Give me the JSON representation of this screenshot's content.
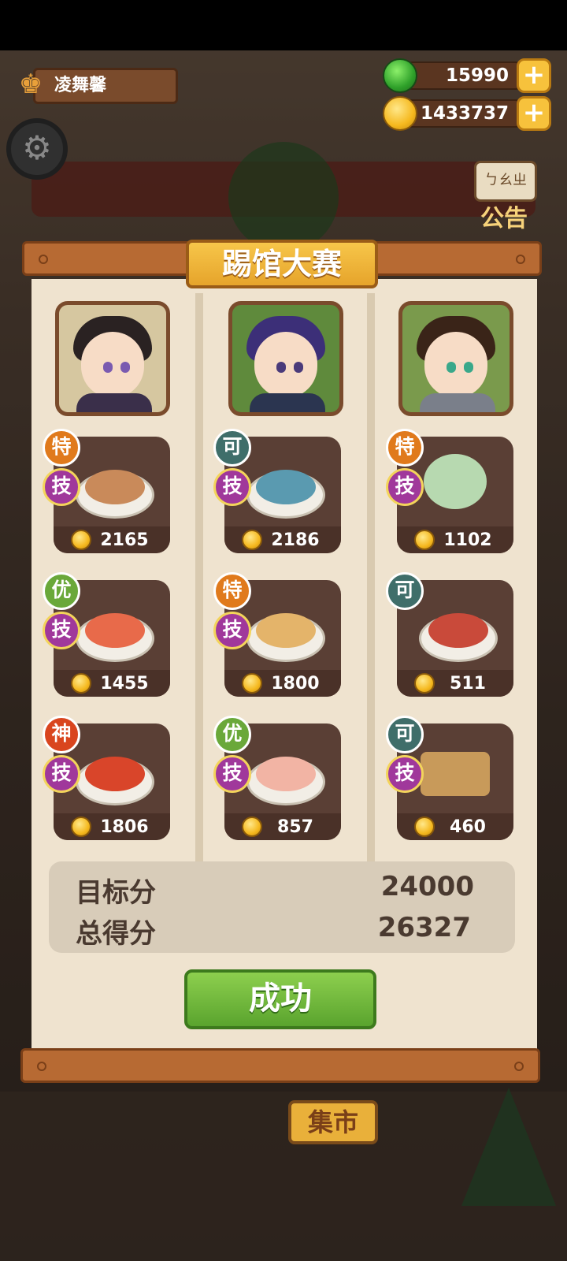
{
  "player": {
    "name": "凌舞馨"
  },
  "currencies": [
    {
      "icon": "green-gem-icon",
      "value": "15990",
      "plus": "+"
    },
    {
      "icon": "gold-coin-icon",
      "value": "1433737",
      "plus": "+"
    }
  ],
  "notice": {
    "sign": "ㄅㄠㄓ",
    "label": "公告"
  },
  "dialog": {
    "title": "踢馆大赛",
    "columns": [
      {
        "character": "long-black-hair-elf",
        "dishes": [
          {
            "grade": "特",
            "skill": "技",
            "score": "2165",
            "food": "dumpling-pot"
          },
          {
            "grade": "优",
            "skill": "技",
            "score": "1455",
            "food": "seafood-salad"
          },
          {
            "grade": "神",
            "skill": "技",
            "score": "1806",
            "food": "crayfish-platter"
          }
        ]
      },
      {
        "character": "purple-hair-elf",
        "dishes": [
          {
            "grade": "可",
            "skill": "技",
            "score": "2186",
            "food": "blue-cake"
          },
          {
            "grade": "特",
            "skill": "技",
            "score": "1800",
            "food": "sponge-cake"
          },
          {
            "grade": "优",
            "skill": "技",
            "score": "857",
            "food": "shrimp-tofu"
          }
        ]
      },
      {
        "character": "curly-hair-girl",
        "dishes": [
          {
            "grade": "特",
            "skill": "技",
            "score": "1102",
            "food": "tea-set"
          },
          {
            "grade": "可",
            "skill": "",
            "score": "511",
            "food": "noodle-bowl"
          },
          {
            "grade": "可",
            "skill": "技",
            "score": "460",
            "food": "sushi-board"
          }
        ]
      }
    ],
    "target_label": "目标分",
    "target_value": "24000",
    "total_label": "总得分",
    "total_value": "26327",
    "result_button": "成功"
  },
  "market": {
    "label": "集市"
  },
  "colors": {
    "grade_te": "#e07a1c",
    "grade_you": "#6aa83a",
    "grade_shen": "#d9451e",
    "grade_ke": "#3f6e6a",
    "skill": "#a0389b"
  }
}
